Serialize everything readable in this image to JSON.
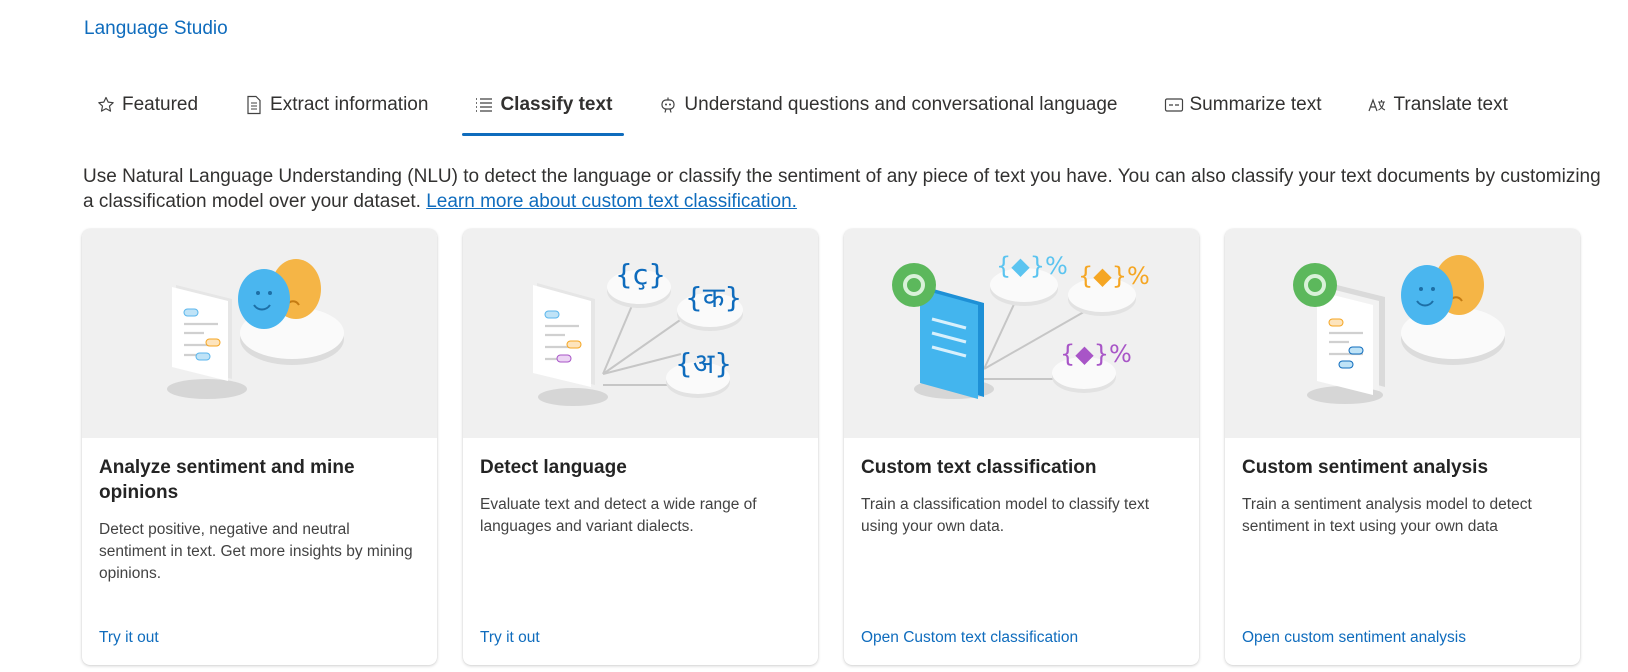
{
  "breadcrumb": {
    "label": "Language Studio"
  },
  "tabs": [
    {
      "label": "Featured",
      "icon": "star-icon",
      "active": false
    },
    {
      "label": "Extract information",
      "icon": "document-icon",
      "active": false
    },
    {
      "label": "Classify text",
      "icon": "list-icon",
      "active": true
    },
    {
      "label": "Understand questions and conversational language",
      "icon": "chat-bot-icon",
      "active": false
    },
    {
      "label": "Summarize text",
      "icon": "summary-icon",
      "active": false
    },
    {
      "label": "Translate text",
      "icon": "translate-icon",
      "active": false
    }
  ],
  "description": {
    "text": "Use Natural Language Understanding (NLU) to detect the language or classify the sentiment of any piece of text you have. You can also classify your text documents by customizing a classification model over your dataset. ",
    "link": "Learn more about custom text classification."
  },
  "cards": [
    {
      "title": "Analyze sentiment and mine opinions",
      "description": "Detect positive, negative and neutral sentiment in text. Get more insights by mining opinions.",
      "link": "Try it out",
      "illustration": "sentiment-illustration"
    },
    {
      "title": "Detect language",
      "description": "Evaluate text and detect a wide range of languages and variant dialects.",
      "link": "Try it out",
      "illustration": "language-illustration"
    },
    {
      "title": "Custom text classification",
      "description": "Train a classification model to classify text using your own data.",
      "link": "Open Custom text classification",
      "illustration": "classification-illustration"
    },
    {
      "title": "Custom sentiment analysis",
      "description": "Train a sentiment analysis model to detect sentiment in text using your own data",
      "link": "Open custom sentiment analysis",
      "illustration": "custom-sentiment-illustration"
    }
  ],
  "colors": {
    "accent": "#0f6cbd",
    "text": "#323130",
    "card_image_bg": "#f0f0f0"
  }
}
